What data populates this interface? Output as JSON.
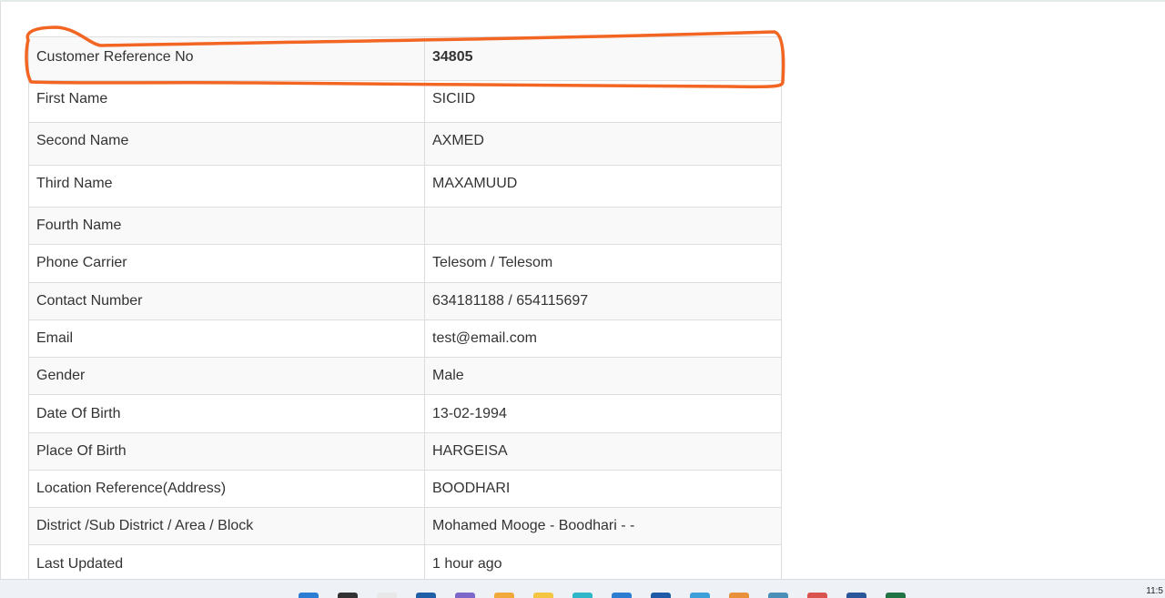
{
  "customer_details": {
    "rows": [
      {
        "label": "Customer Reference No",
        "value": "34805"
      },
      {
        "label": "First Name",
        "value": "SICIID"
      },
      {
        "label": "Second Name",
        "value": "AXMED"
      },
      {
        "label": "Third Name",
        "value": "MAXAMUUD"
      },
      {
        "label": "Fourth Name",
        "value": ""
      },
      {
        "label": "Phone Carrier",
        "value": "Telesom / Telesom"
      },
      {
        "label": "Contact Number",
        "value": "634181188 / 654115697"
      },
      {
        "label": "Email",
        "value": "test@email.com"
      },
      {
        "label": "Gender",
        "value": "Male"
      },
      {
        "label": "Date Of Birth",
        "value": "13-02-1994"
      },
      {
        "label": "Place Of Birth",
        "value": "HARGEISA"
      },
      {
        "label": "Location Reference(Address)",
        "value": "BOODHARI"
      },
      {
        "label": "District /Sub District / Area / Block",
        "value": "Mohamed Mooge - Boodhari - -"
      },
      {
        "label": "Last Updated",
        "value": "1 hour ago"
      }
    ]
  },
  "annotation": {
    "color": "#f26522"
  },
  "taskbar": {
    "clock": "11:5",
    "icons": [
      {
        "name": "windows-start-icon",
        "color": "#2b7cd3"
      },
      {
        "name": "search-icon",
        "color": "#333333"
      },
      {
        "name": "file-icon",
        "color": "#e8e8e8"
      },
      {
        "name": "task-view-icon",
        "color": "#1f5fa8"
      },
      {
        "name": "chat-icon",
        "color": "#7b68c8"
      },
      {
        "name": "paint-icon",
        "color": "#f2a93b"
      },
      {
        "name": "folder-icon",
        "color": "#f4c542"
      },
      {
        "name": "edge-icon",
        "color": "#2fb7c9"
      },
      {
        "name": "briefcase-icon",
        "color": "#2d7dd2"
      },
      {
        "name": "store-icon",
        "color": "#1e5aa8"
      },
      {
        "name": "app-icon",
        "color": "#3ea0d8"
      },
      {
        "name": "package-icon",
        "color": "#e8903a"
      },
      {
        "name": "monitor-icon",
        "color": "#4a8fb8"
      },
      {
        "name": "calendar-icon",
        "color": "#d9534f"
      },
      {
        "name": "word-icon",
        "color": "#2b579a"
      },
      {
        "name": "excel-icon",
        "color": "#217346"
      }
    ]
  }
}
